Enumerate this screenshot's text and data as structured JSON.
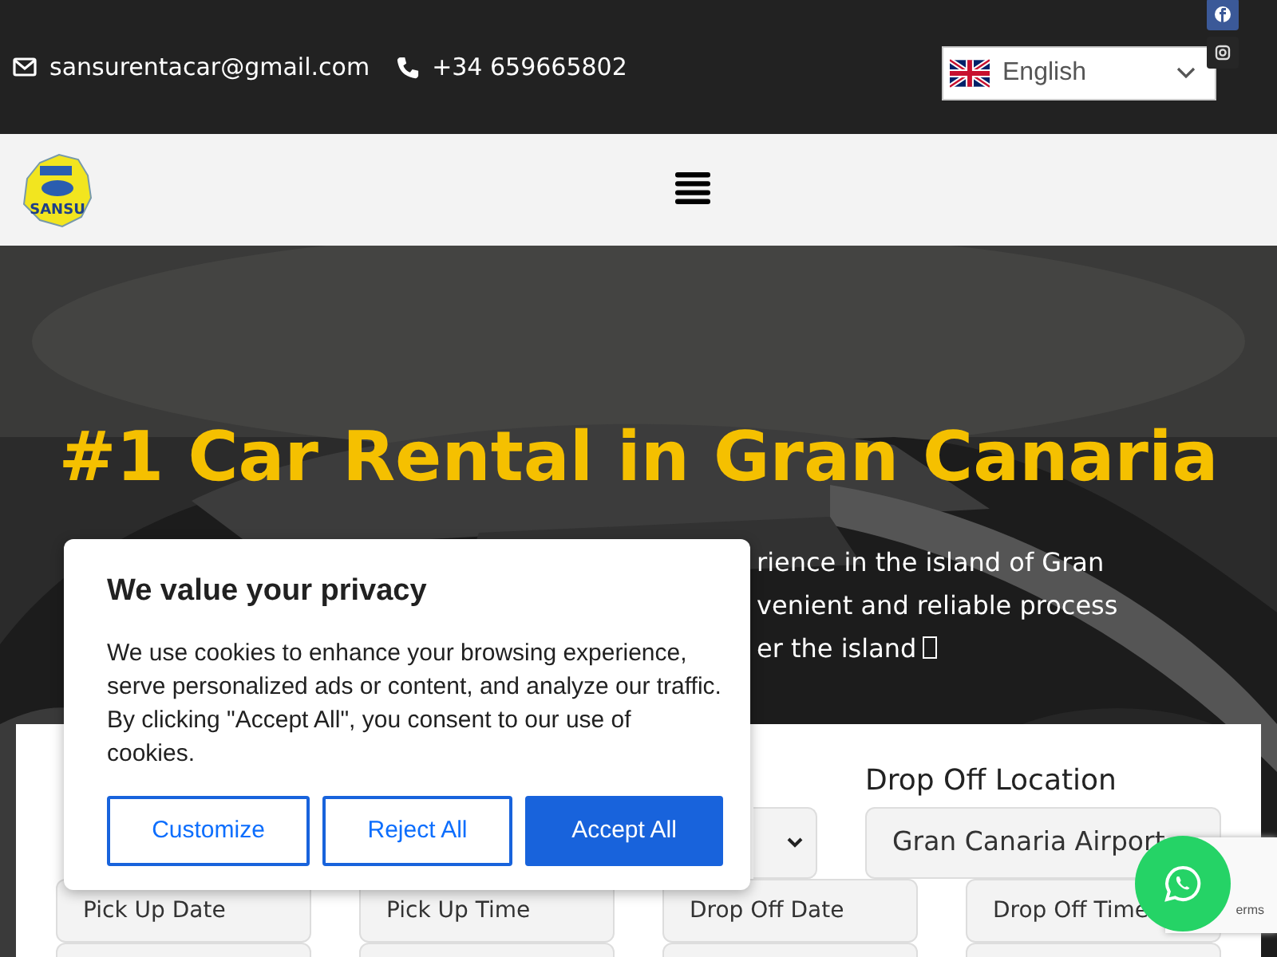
{
  "top_bar": {
    "email": "sansurentacar@gmail.com",
    "phone": "+34 659665802",
    "language": "English"
  },
  "header": {
    "logo_text": "SANSU"
  },
  "hero": {
    "title": "#1 Car Rental in Gran Canaria",
    "lines": [
      "rience in the island of Gran",
      "venient and reliable process",
      "er the island"
    ]
  },
  "form": {
    "columns": [
      {
        "label": "Drop Off Location",
        "value": "Gran Canaria Airport"
      }
    ],
    "date_fields": [
      {
        "placeholder": "Pick Up Date"
      },
      {
        "placeholder": "Pick Up Time"
      },
      {
        "placeholder": "Drop Off Date"
      },
      {
        "placeholder": "Drop Off Time"
      }
    ]
  },
  "cookie_banner": {
    "title": "We value your privacy",
    "text": "We use cookies to enhance your browsing experience, serve personalized ads or content, and analyze our traffic. By clicking \"Accept All\", you consent to our use of cookies.",
    "buttons": [
      {
        "label": "Customize",
        "kind": "outline"
      },
      {
        "label": "Reject All",
        "kind": "outline"
      },
      {
        "label": "Accept All",
        "kind": "primary"
      }
    ]
  },
  "recaptcha": {
    "text": "erms"
  }
}
